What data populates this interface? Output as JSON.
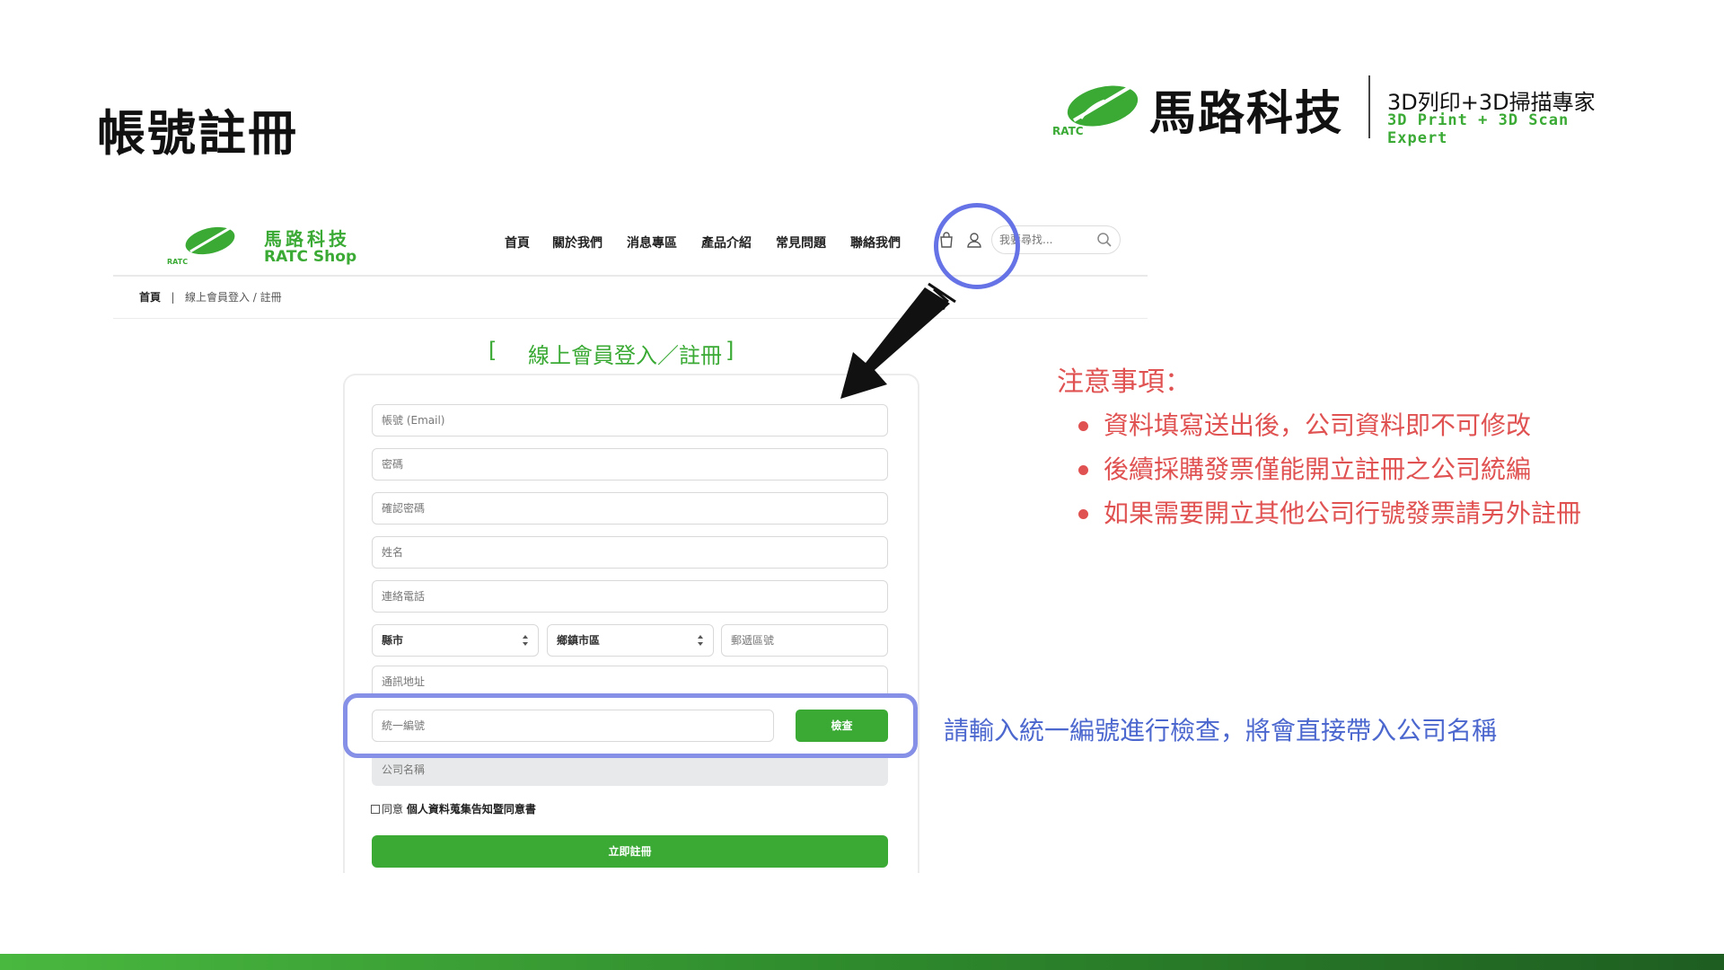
{
  "slide": {
    "title": "帳號註冊",
    "brand": {
      "name": "馬路科技",
      "tag": "RATC",
      "slogan": "3D列印+3D掃描專家",
      "slogan_en": "3D Print + 3D Scan Expert"
    }
  },
  "site": {
    "logo": {
      "tag": "RATC",
      "name": "馬路科技",
      "shop": "RATC Shop"
    },
    "nav": [
      "首頁",
      "關於我們",
      "消息專區",
      "產品介紹",
      "常見問題",
      "聯絡我們"
    ],
    "search": {
      "placeholder": "我要尋找..."
    },
    "breadcrumb": {
      "home": "首頁",
      "separator": "|",
      "path": "線上會員登入 / 註冊"
    },
    "form": {
      "title_open": "[",
      "title": "線上會員登入／註冊",
      "title_close": "]",
      "fields": {
        "account": "帳號 (Email)",
        "password": "密碼",
        "confirm": "確認密碼",
        "name": "姓名",
        "phone": "連絡電話",
        "city": "縣市",
        "district": "鄉鎮市區",
        "zipcode": "郵遞區號",
        "address": "通訊地址",
        "tax_id": "統一編號",
        "company": "公司名稱"
      },
      "check_button": "檢查",
      "agree_prefix": "同意",
      "agree_link": "個人資料蒐集告知暨同意書",
      "submit_button": "立即註冊"
    }
  },
  "annotations": {
    "notes_title": "注意事項：",
    "notes": [
      "資料填寫送出後，公司資料即不可修改",
      "後續採購發票僅能開立註冊之公司統編",
      "如果需要開立其他公司行號發票請另外註冊"
    ],
    "tip": "請輸入統一編號進行檢查，將會直接帶入公司名稱"
  },
  "colors": {
    "brand_green": "#3aaa35",
    "note_red": "#e05252",
    "tip_blue": "#4c68cf",
    "highlight": "#6673e6"
  }
}
